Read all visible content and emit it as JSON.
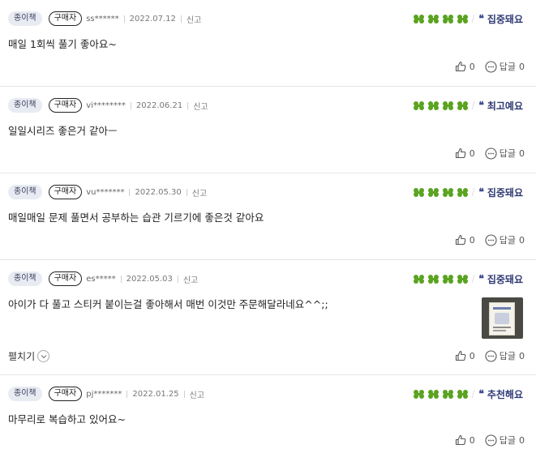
{
  "colors": {
    "clover": "#5aa320",
    "tag": "#2f3a74",
    "badge_bg": "#e9ebf3"
  },
  "reviews": [
    {
      "type": "종이책",
      "buyer": "구매자",
      "user": "ss******",
      "date": "2022.07.12",
      "report": "신고",
      "tag": "집중돼요",
      "content": "매일 1회씩 풀기 좋아요~",
      "likes": "0",
      "reply": "답글",
      "replies": "0"
    },
    {
      "type": "종이책",
      "buyer": "구매자",
      "user": "vi********",
      "date": "2022.06.21",
      "report": "신고",
      "tag": "최고예요",
      "content": "일일시리즈 좋은거 같아ㅡ",
      "likes": "0",
      "reply": "답글",
      "replies": "0"
    },
    {
      "type": "종이책",
      "buyer": "구매자",
      "user": "vu*******",
      "date": "2022.05.30",
      "report": "신고",
      "tag": "집중돼요",
      "content": "매일매일 문제 풀면서 공부하는 습관 기르기에 좋은것 같아요",
      "likes": "0",
      "reply": "답글",
      "replies": "0"
    },
    {
      "type": "종이책",
      "buyer": "구매자",
      "user": "es*****",
      "date": "2022.05.03",
      "report": "신고",
      "tag": "집중돼요",
      "content": "아이가 다 풀고 스티커 붙이는걸 좋아해서 매번 이것만 주문해달라네요^^;;",
      "expand": "펼치기",
      "likes": "0",
      "reply": "답글",
      "replies": "0"
    },
    {
      "type": "종이책",
      "buyer": "구매자",
      "user": "pj*******",
      "date": "2022.01.25",
      "report": "신고",
      "tag": "추천해요",
      "content": "마무리로 복습하고 있어요~",
      "likes": "0",
      "reply": "답글",
      "replies": "0"
    }
  ]
}
